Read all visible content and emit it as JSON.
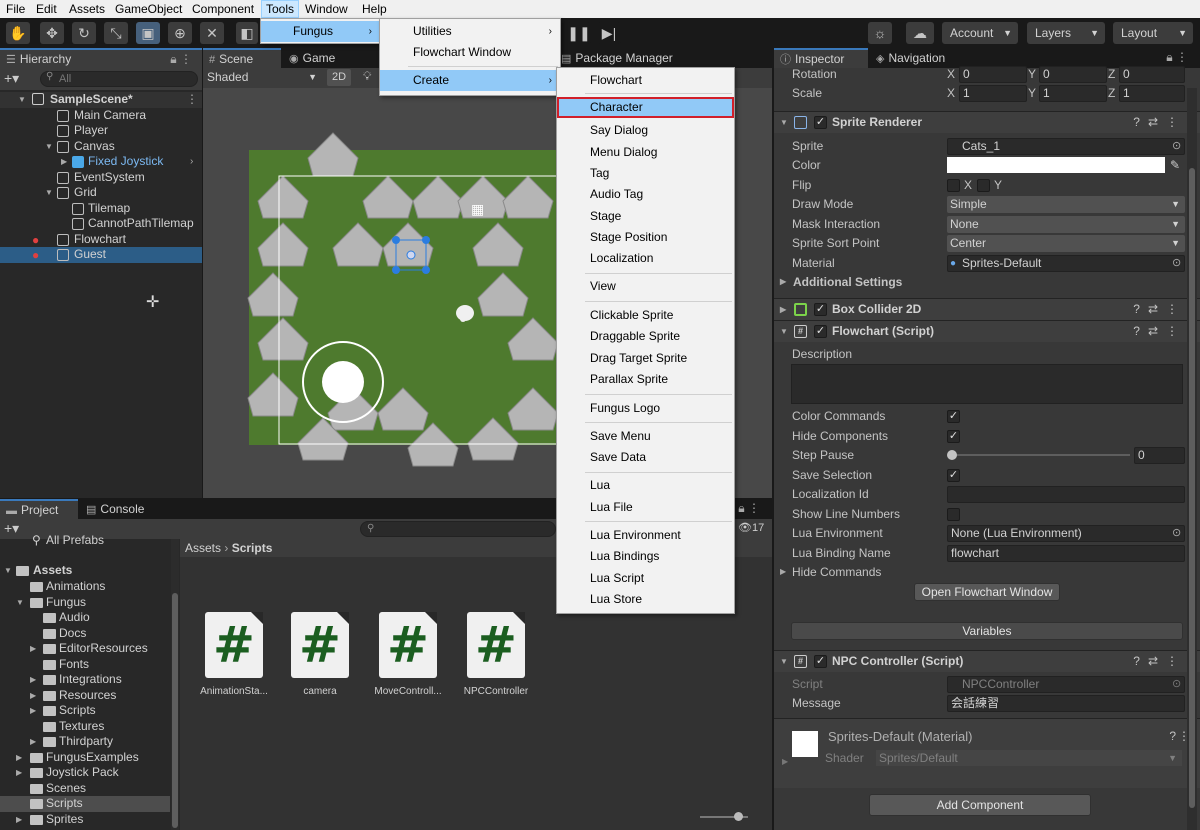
{
  "menubar": [
    "File",
    "Edit",
    "Assets",
    "GameObject",
    "Component",
    "Tools",
    "Window",
    "Help"
  ],
  "toolbar": {
    "account": "Account",
    "layers": "Layers",
    "layout": "Layout"
  },
  "tools_menu": {
    "fungus": "Fungus"
  },
  "fungus_menu": {
    "utilities": "Utilities",
    "flowchart_window": "Flowchart Window",
    "create": "Create"
  },
  "create_menu": [
    "Flowchart",
    "Character",
    "Say Dialog",
    "Menu Dialog",
    "Tag",
    "Audio Tag",
    "Stage",
    "Stage Position",
    "Localization",
    "View",
    "Clickable Sprite",
    "Draggable Sprite",
    "Drag Target Sprite",
    "Parallax Sprite",
    "Fungus Logo",
    "Save Menu",
    "Save Data",
    "Lua",
    "Lua File",
    "Lua Environment",
    "Lua Bindings",
    "Lua Script",
    "Lua Store"
  ],
  "hierarchy": {
    "tab": "Hierarchy",
    "search_placeholder": "All",
    "scene": "SampleScene*",
    "items": [
      "Main Camera",
      "Player",
      "Canvas",
      "Fixed Joystick",
      "EventSystem",
      "Grid",
      "Tilemap",
      "CannotPathTilemap",
      "Flowchart",
      "Guest"
    ]
  },
  "scene_tabs": {
    "scene": "Scene",
    "game": "Game",
    "shaded": "Shaded",
    "mode2d": "2D",
    "package_manager": "Package Manager"
  },
  "project": {
    "tab": "Project",
    "console": "Console",
    "all_prefabs": "All Prefabs",
    "hidden_count": "17",
    "breadcrumb_root": "Assets",
    "breadcrumb_leaf": "Scripts",
    "folders": [
      "Assets",
      "Animations",
      "Fungus",
      "Audio",
      "Docs",
      "EditorResources",
      "Fonts",
      "Integrations",
      "Resources",
      "Scripts",
      "Textures",
      "Thirdparty",
      "FungusExamples",
      "Joystick Pack",
      "Scenes",
      "Scripts",
      "Sprites"
    ],
    "assets": [
      "AnimationSta...",
      "camera",
      "MoveControll...",
      "NPCController"
    ]
  },
  "inspector": {
    "tab": "Inspector",
    "nav_tab": "Navigation",
    "rotation": {
      "label": "Rotation",
      "x": "0",
      "y": "0",
      "z": "0"
    },
    "scale": {
      "label": "Scale",
      "x": "1",
      "y": "1",
      "z": "1"
    },
    "sprite_renderer": {
      "title": "Sprite Renderer",
      "sprite_label": "Sprite",
      "sprite": "Cats_1",
      "color_label": "Color",
      "flip_label": "Flip",
      "flip_x": "X",
      "flip_y": "Y",
      "draw_mode_label": "Draw Mode",
      "draw_mode": "Simple",
      "mask_label": "Mask Interaction",
      "mask": "None",
      "sort_label": "Sprite Sort Point",
      "sort": "Center",
      "material_label": "Material",
      "material": "Sprites-Default",
      "additional": "Additional Settings"
    },
    "box_collider": "Box Collider 2D",
    "flowchart": {
      "title": "Flowchart (Script)",
      "description": "Description",
      "color_commands": "Color Commands",
      "hide_components": "Hide Components",
      "step_pause": "Step Pause",
      "step_pause_value": "0",
      "save_selection": "Save Selection",
      "localization_id": "Localization Id",
      "show_line_numbers": "Show Line Numbers",
      "lua_env_label": "Lua Environment",
      "lua_env": "None (Lua Environment)",
      "lua_binding_label": "Lua Binding Name",
      "lua_binding": "flowchart",
      "hide_commands": "Hide Commands",
      "open_window": "Open Flowchart Window",
      "variables": "Variables"
    },
    "npc": {
      "title": "NPC Controller (Script)",
      "script_label": "Script",
      "script": "NPCController",
      "message_label": "Message",
      "message": "会話練習"
    },
    "material": {
      "title": "Sprites-Default (Material)",
      "shader_label": "Shader",
      "shader": "Sprites/Default"
    },
    "add_component": "Add Component"
  },
  "colors": {
    "selection": "#2c5d87",
    "menu_highlight": "#91c9f7",
    "highlight_border": "#d11f2a",
    "grass": "#4e7a2e"
  }
}
